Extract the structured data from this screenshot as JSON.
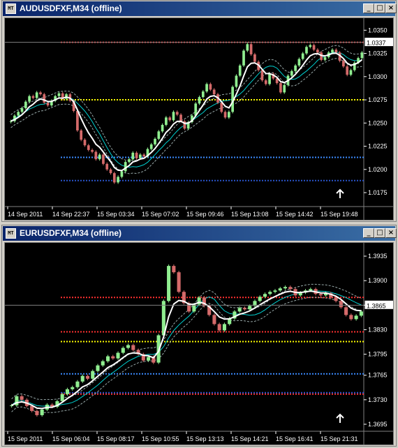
{
  "windows": [
    {
      "title": "AUDUSDFXF,M34 (offline)",
      "icon": "chart-window-icon",
      "buttons": [
        "_",
        "□",
        "×"
      ],
      "chart_data": {
        "type": "candlestick",
        "symbol": "AUDUSDFXF",
        "timeframe": "M34",
        "ylim": [
          1.016,
          1.036
        ],
        "y_ticks": [
          "1.0350",
          "1.0325",
          "1.0300",
          "1.0275",
          "1.0250",
          "1.0225",
          "1.0200",
          "1.0175"
        ],
        "current_price": "1.0337",
        "x_ticks": [
          "14 Sep 2011",
          "14 Sep 22:37",
          "15 Sep 03:34",
          "15 Sep 07:02",
          "15 Sep 09:46",
          "15 Sep 13:08",
          "15 Sep 14:42",
          "15 Sep 19:48"
        ],
        "close": [
          1.0252,
          1.0258,
          1.0262,
          1.0266,
          1.0273,
          1.0279,
          1.0277,
          1.0283,
          1.0281,
          1.0272,
          1.0269,
          1.0274,
          1.0279,
          1.0282,
          1.0276,
          1.0281,
          1.0274,
          1.0263,
          1.0242,
          1.0232,
          1.0226,
          1.0221,
          1.0219,
          1.0211,
          1.0216,
          1.0206,
          1.02,
          1.0196,
          1.0186,
          1.0192,
          1.0198,
          1.0208,
          1.0211,
          1.0218,
          1.0212,
          1.0216,
          1.0214,
          1.0222,
          1.0227,
          1.0233,
          1.0241,
          1.0248,
          1.0256,
          1.0253,
          1.0262,
          1.0259,
          1.0252,
          1.0244,
          1.0251,
          1.0258,
          1.0271,
          1.0278,
          1.0284,
          1.0292,
          1.0286,
          1.0281,
          1.0272,
          1.0262,
          1.0256,
          1.0262,
          1.0289,
          1.0301,
          1.0312,
          1.0328,
          1.0335,
          1.0324,
          1.0316,
          1.0307,
          1.0296,
          1.0292,
          1.0303,
          1.0298,
          1.0293,
          1.0283,
          1.0291,
          1.0301,
          1.0306,
          1.0312,
          1.0319,
          1.0325,
          1.0332,
          1.0334,
          1.0329,
          1.0326,
          1.0318,
          1.0321,
          1.0326,
          1.0329,
          1.0326,
          1.0317,
          1.0311,
          1.0302,
          1.0307,
          1.0315,
          1.032,
          1.0326
        ],
        "price_levels": [
          {
            "value": 1.0337,
            "color": "#ff3030",
            "style": "dotted"
          },
          {
            "value": 1.0275,
            "color": "#ffff00",
            "style": "dotted"
          },
          {
            "value": 1.0213,
            "color": "#3b8bff",
            "style": "dotted"
          },
          {
            "value": 1.0188,
            "color": "#2a55cc",
            "style": "dotted"
          }
        ],
        "arrow": "up"
      }
    },
    {
      "title": "EURUSDFXF,M34 (offline)",
      "icon": "chart-window-icon",
      "buttons": [
        "_",
        "□",
        "×"
      ],
      "chart_data": {
        "type": "candlestick",
        "symbol": "EURUSDFXF",
        "timeframe": "M34",
        "ylim": [
          1.3685,
          1.395
        ],
        "y_ticks": [
          "1.3935",
          "1.3900",
          "1.3865",
          "1.3830",
          "1.3795",
          "1.3765",
          "1.3730",
          "1.3695"
        ],
        "current_price": "1.3865",
        "x_ticks": [
          "15 Sep 2011",
          "15 Sep 06:04",
          "15 Sep 08:17",
          "15 Sep 10:55",
          "15 Sep 13:13",
          "15 Sep 14:21",
          "15 Sep 16:41",
          "15 Sep 21:31"
        ],
        "close": [
          1.3722,
          1.3735,
          1.373,
          1.3721,
          1.3714,
          1.3708,
          1.3716,
          1.3723,
          1.372,
          1.3728,
          1.3738,
          1.3745,
          1.3748,
          1.3756,
          1.3764,
          1.376,
          1.3771,
          1.3779,
          1.3785,
          1.3792,
          1.3789,
          1.3797,
          1.3804,
          1.3808,
          1.3801,
          1.3795,
          1.3786,
          1.3791,
          1.3783,
          1.3822,
          1.3871,
          1.3921,
          1.3912,
          1.3884,
          1.3868,
          1.3856,
          1.3866,
          1.3876,
          1.3864,
          1.3851,
          1.3838,
          1.3829,
          1.3838,
          1.3846,
          1.3856,
          1.3861,
          1.3859,
          1.3864,
          1.3871,
          1.3877,
          1.3881,
          1.3884,
          1.3886,
          1.3889,
          1.3891,
          1.3888,
          1.3879,
          1.3883,
          1.3886,
          1.3888,
          1.3881,
          1.3879,
          1.3882,
          1.3876,
          1.3871,
          1.3862,
          1.3851,
          1.3845,
          1.385,
          1.3856
        ],
        "price_levels": [
          {
            "value": 1.3876,
            "color": "#ff3030",
            "style": "dotted"
          },
          {
            "value": 1.3827,
            "color": "#ff3030",
            "style": "dotted"
          },
          {
            "value": 1.3738,
            "color": "#ff3030",
            "style": "dotted"
          },
          {
            "value": 1.3813,
            "color": "#ffff00",
            "style": "dotted"
          },
          {
            "value": 1.3767,
            "color": "#3b8bff",
            "style": "dotted"
          },
          {
            "value": 1.374,
            "color": "#2a55cc",
            "style": "dotted"
          }
        ],
        "arrow": "up"
      }
    }
  ]
}
